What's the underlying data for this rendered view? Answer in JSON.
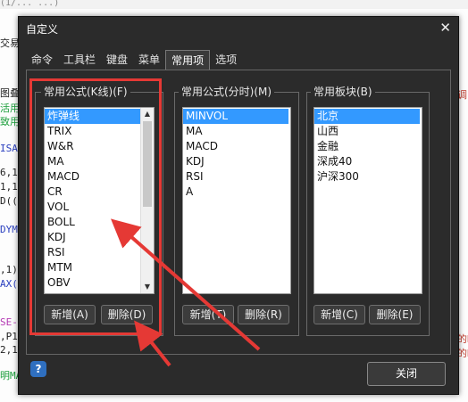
{
  "background": {
    "top_text": "(1/... ...)",
    "left_fragments": [
      "交易",
      "图叠",
      "活用",
      "致用",
      "ISA",
      "6,1",
      "1,1",
      "D((",
      "DYM",
      ",1)",
      "AX(",
      "SE-",
      ",P1",
      "2,1",
      "明MA"
    ],
    "right_fragments": [
      "调",
      "的K",
      "的K"
    ]
  },
  "dialog": {
    "title": "自定义",
    "close_label": "✕",
    "tabs": [
      {
        "label": "命令"
      },
      {
        "label": "工具栏"
      },
      {
        "label": "键盘"
      },
      {
        "label": "菜单"
      },
      {
        "label": "常用项"
      },
      {
        "label": "选项"
      }
    ],
    "active_tab": "常用项",
    "groups": {
      "kline": {
        "title": "常用公式(K线)(F)",
        "items": [
          "炸弹线",
          "TRIX",
          "W&R",
          "MA",
          "MACD",
          "CR",
          "VOL",
          "BOLL",
          "KDJ",
          "RSI",
          "MTM",
          "OBV"
        ],
        "selected": "炸弹线",
        "add_label": "新增(A)",
        "delete_label": "删除(D)"
      },
      "timeshare": {
        "title": "常用公式(分时)(M)",
        "items": [
          "MINVOL",
          "MA",
          "MACD",
          "KDJ",
          "RSI",
          "A"
        ],
        "selected": "MINVOL",
        "add_label": "新增(T)",
        "delete_label": "删除(R)"
      },
      "sector": {
        "title": "常用板块(B)",
        "items": [
          "北京",
          "山西",
          "金融",
          "深成40",
          "沪深300"
        ],
        "selected": "北京",
        "add_label": "新增(C)",
        "delete_label": "删除(E)"
      }
    },
    "help_label": "?",
    "ok_label": "关闭"
  },
  "colors": {
    "highlight": "#e53935",
    "selection": "#3399ff"
  }
}
